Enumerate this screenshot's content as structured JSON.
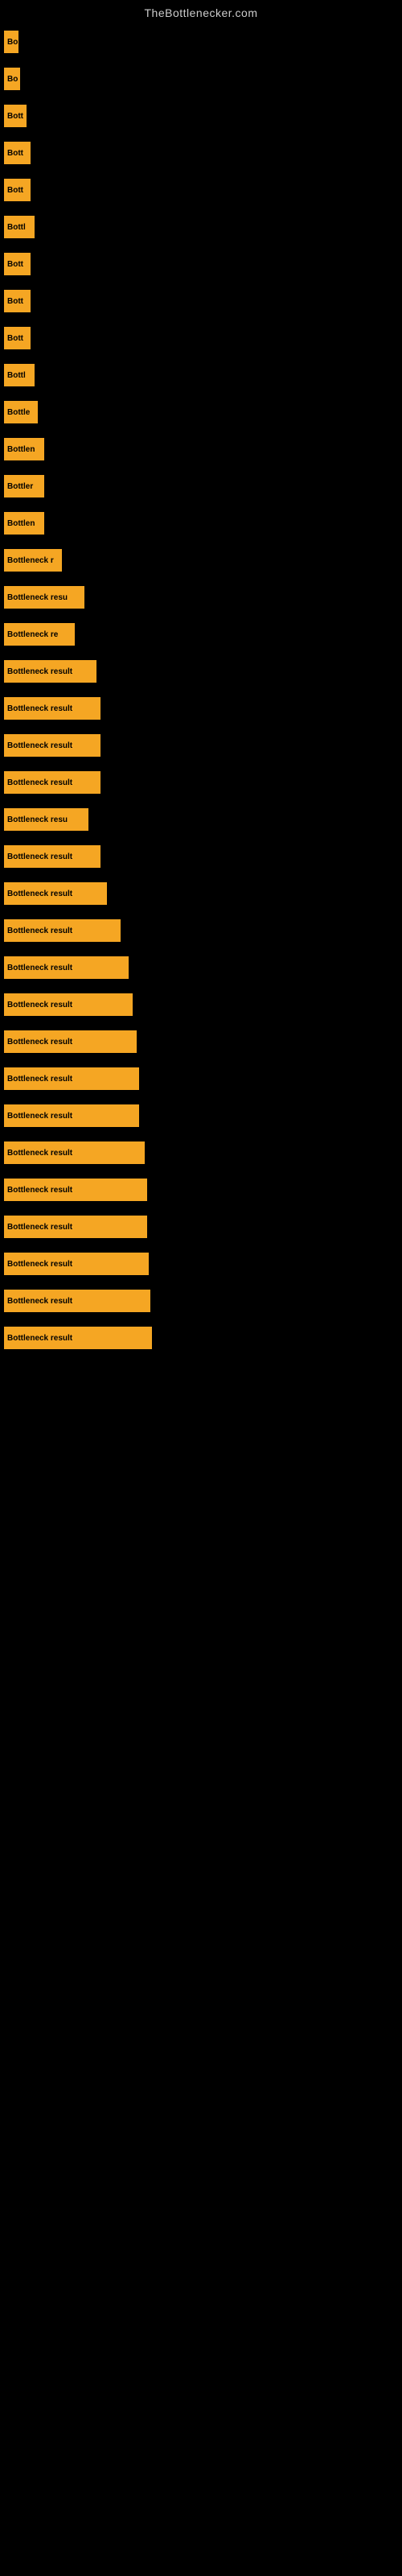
{
  "site": {
    "title": "TheBottlenecker.com"
  },
  "bars": [
    {
      "id": 1,
      "label": "Bo",
      "width": 18
    },
    {
      "id": 2,
      "label": "Bo",
      "width": 20
    },
    {
      "id": 3,
      "label": "Bott",
      "width": 28
    },
    {
      "id": 4,
      "label": "Bott",
      "width": 33
    },
    {
      "id": 5,
      "label": "Bott",
      "width": 33
    },
    {
      "id": 6,
      "label": "Bottl",
      "width": 38
    },
    {
      "id": 7,
      "label": "Bott",
      "width": 33
    },
    {
      "id": 8,
      "label": "Bott",
      "width": 33
    },
    {
      "id": 9,
      "label": "Bott",
      "width": 33
    },
    {
      "id": 10,
      "label": "Bottl",
      "width": 38
    },
    {
      "id": 11,
      "label": "Bottle",
      "width": 42
    },
    {
      "id": 12,
      "label": "Bottlen",
      "width": 50
    },
    {
      "id": 13,
      "label": "Bottler",
      "width": 50
    },
    {
      "id": 14,
      "label": "Bottlen",
      "width": 50
    },
    {
      "id": 15,
      "label": "Bottleneck r",
      "width": 72
    },
    {
      "id": 16,
      "label": "Bottleneck resu",
      "width": 100
    },
    {
      "id": 17,
      "label": "Bottleneck re",
      "width": 88
    },
    {
      "id": 18,
      "label": "Bottleneck result",
      "width": 115
    },
    {
      "id": 19,
      "label": "Bottleneck result",
      "width": 120
    },
    {
      "id": 20,
      "label": "Bottleneck result",
      "width": 120
    },
    {
      "id": 21,
      "label": "Bottleneck result",
      "width": 120
    },
    {
      "id": 22,
      "label": "Bottleneck resu",
      "width": 105
    },
    {
      "id": 23,
      "label": "Bottleneck result",
      "width": 120
    },
    {
      "id": 24,
      "label": "Bottleneck result",
      "width": 128
    },
    {
      "id": 25,
      "label": "Bottleneck result",
      "width": 145
    },
    {
      "id": 26,
      "label": "Bottleneck result",
      "width": 155
    },
    {
      "id": 27,
      "label": "Bottleneck result",
      "width": 160
    },
    {
      "id": 28,
      "label": "Bottleneck result",
      "width": 165
    },
    {
      "id": 29,
      "label": "Bottleneck result",
      "width": 168
    },
    {
      "id": 30,
      "label": "Bottleneck result",
      "width": 168
    },
    {
      "id": 31,
      "label": "Bottleneck result",
      "width": 175
    },
    {
      "id": 32,
      "label": "Bottleneck result",
      "width": 178
    },
    {
      "id": 33,
      "label": "Bottleneck result",
      "width": 178
    },
    {
      "id": 34,
      "label": "Bottleneck result",
      "width": 180
    },
    {
      "id": 35,
      "label": "Bottleneck result",
      "width": 182
    },
    {
      "id": 36,
      "label": "Bottleneck result",
      "width": 184
    }
  ]
}
